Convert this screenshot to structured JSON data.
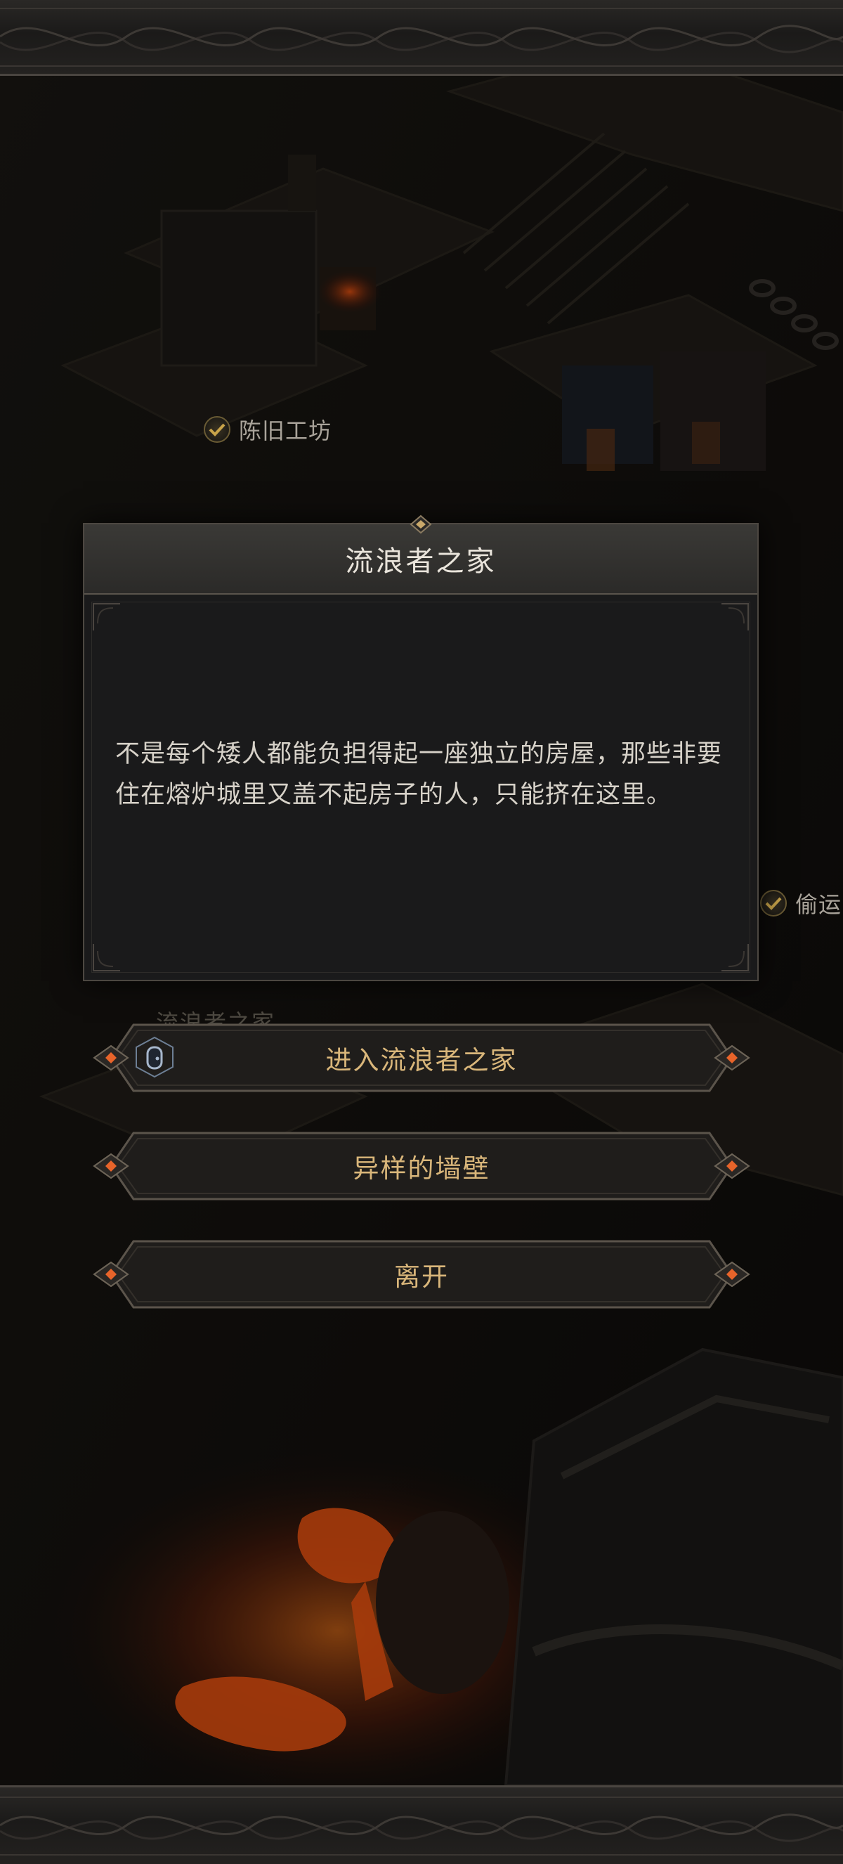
{
  "map": {
    "labels": [
      {
        "text": "陈旧工坊",
        "checked": true
      },
      {
        "text": "偷运",
        "checked": true
      }
    ],
    "ghost_label": "流浪者之家"
  },
  "dialog": {
    "title": "流浪者之家",
    "description": "不是每个矮人都能负担得起一座独立的房屋，那些非要住在熔炉城里又盖不起房子的人，只能挤在这里。"
  },
  "options": [
    {
      "label": "进入流浪者之家",
      "icon": "door-icon"
    },
    {
      "label": "异样的墙壁"
    },
    {
      "label": "离开"
    }
  ],
  "colors": {
    "accent_gold": "#d9b67a",
    "gem_orange": "#e8642a",
    "lava": "#ff5a12",
    "panel": "#1a1a1b"
  }
}
